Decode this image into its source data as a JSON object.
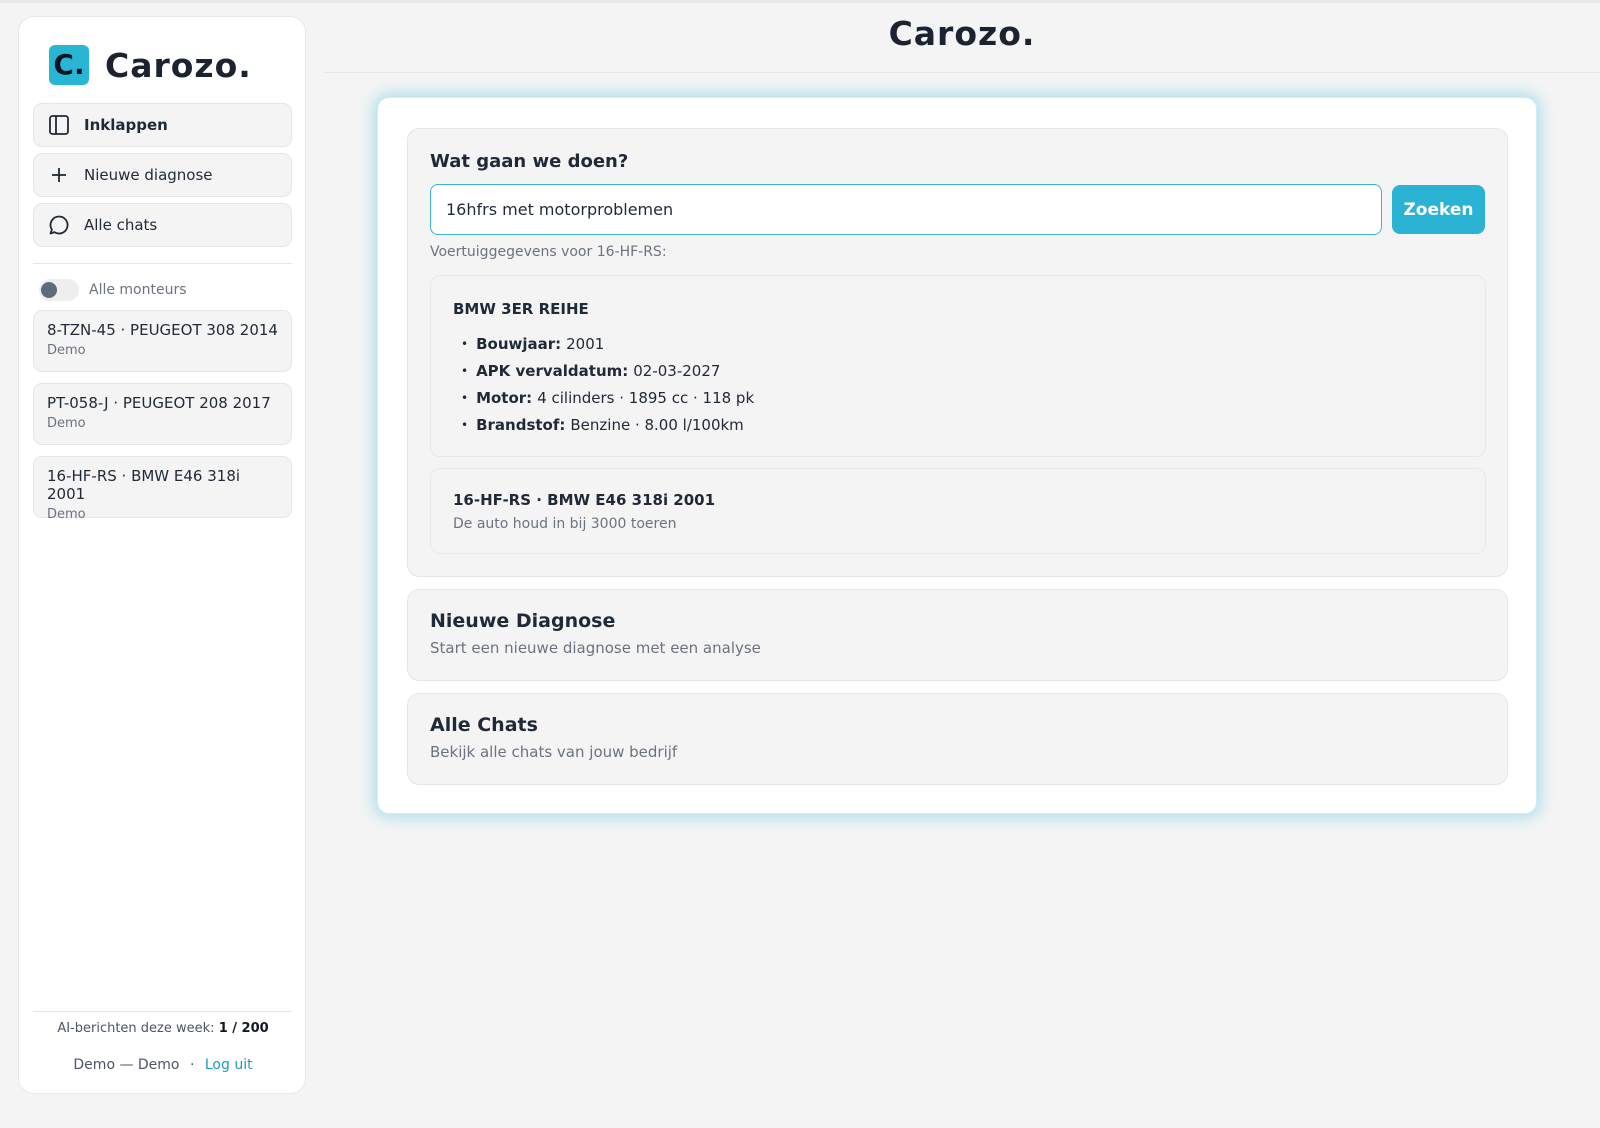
{
  "brand": {
    "logo_letter": "C.",
    "name": "Carozo.",
    "accent_color": "#2bb3d4"
  },
  "sidebar": {
    "nav": [
      {
        "label": "Inklappen",
        "icon": "sidebar-panel-icon"
      },
      {
        "label": "Nieuwe diagnose",
        "icon": "plus-icon"
      },
      {
        "label": "Alle chats",
        "icon": "chat-bubble-icon"
      }
    ],
    "toggle_label": "Alle monteurs",
    "toggle_on": false,
    "chats": [
      {
        "title": "8-TZN-45 · PEUGEOT 308 2014",
        "sub": "Demo"
      },
      {
        "title": "PT-058-J · PEUGEOT 208 2017",
        "sub": "Demo"
      },
      {
        "title": "16-HF-RS · BMW E46 318i 2001",
        "sub": "Demo"
      }
    ],
    "usage_label": "AI-berichten deze week:",
    "usage_value": "1 / 200",
    "user": "Demo — Demo",
    "separator": "·",
    "logout": "Log uit"
  },
  "main": {
    "title": "Carozo.",
    "search": {
      "heading": "Wat gaan we doen?",
      "value": "16hfrs met motorproblemen",
      "button": "Zoeken"
    },
    "vehicle_caption": "Voertuiggegevens voor 16-HF-RS:",
    "vehicle": {
      "model": "BMW 3ER REIHE",
      "details": [
        {
          "key": "Bouwjaar:",
          "value": "2001"
        },
        {
          "key": "APK vervaldatum:",
          "value": "02-03-2027"
        },
        {
          "key": "Motor:",
          "value": "4 cilinders · 1895 cc · 118 pk"
        },
        {
          "key": "Brandstof:",
          "value": "Benzine · 8.00 l/100km"
        }
      ]
    },
    "result": {
      "title": "16-HF-RS · BMW E46 318i 2001",
      "sub": "De auto houd in bij 3000 toeren"
    },
    "actions": [
      {
        "title": "Nieuwe Diagnose",
        "sub": "Start een nieuwe diagnose met een analyse"
      },
      {
        "title": "Alle Chats",
        "sub": "Bekijk alle chats van jouw bedrijf"
      }
    ]
  }
}
